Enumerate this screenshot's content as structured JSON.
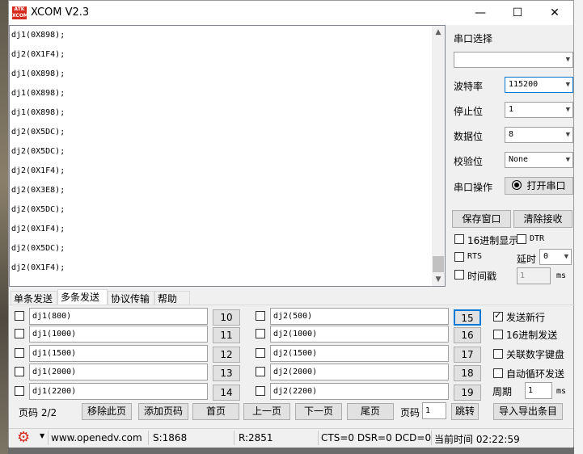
{
  "window": {
    "title": "XCOM V2.3",
    "logo_text": "ATK\nXCOM",
    "minimize": "—",
    "maximize": "☐",
    "close": "✕"
  },
  "receive": {
    "lines": [
      "dj1(0X898);",
      "dj2(0X1F4);",
      "dj1(0X898);",
      "dj1(0X898);",
      "dj1(0X898);",
      "dj2(0X5DC);",
      "dj2(0X5DC);",
      "dj2(0X1F4);",
      "dj2(0X3E8);",
      "dj2(0X5DC);",
      "dj2(0X1F4);",
      "dj2(0X5DC);",
      "dj2(0X1F4);"
    ]
  },
  "serial": {
    "port_select_label": "串口选择",
    "port_value": "",
    "baud_label": "波特率",
    "baud_value": "115200",
    "stop_label": "停止位",
    "stop_value": "1",
    "data_label": "数据位",
    "data_value": "8",
    "parity_label": "校验位",
    "parity_value": "None",
    "op_label": "串口操作",
    "open_button": "打开串口",
    "save_button": "保存窗口",
    "clear_button": "清除接收",
    "hex_display": "16进制显示",
    "dtr": "DTR",
    "rts": "RTS",
    "delay_label": "延时",
    "delay_value": "0",
    "timestamp": "时间戳",
    "timestamp_value": "1",
    "ms": "ms"
  },
  "tabs": [
    "单条发送",
    "多条发送",
    "协议传输",
    "帮助"
  ],
  "multi_send": {
    "left": [
      {
        "text": "dj1(800)",
        "num": "10"
      },
      {
        "text": "dj1(1000)",
        "num": "11"
      },
      {
        "text": "dj1(1500)",
        "num": "12"
      },
      {
        "text": "dj1(2000)",
        "num": "13"
      },
      {
        "text": "dj1(2200)",
        "num": "14"
      }
    ],
    "right": [
      {
        "text": "dj2(500)",
        "num": "15"
      },
      {
        "text": "dj2(1000)",
        "num": "16"
      },
      {
        "text": "dj2(1500)",
        "num": "17"
      },
      {
        "text": "dj2(2000)",
        "num": "18"
      },
      {
        "text": "dj2(2200)",
        "num": "19"
      }
    ],
    "options": {
      "send_newline": "发送新行",
      "hex_send": "16进制发送",
      "link_keypad": "关联数字键盘",
      "auto_loop": "自动循环发送",
      "period_label": "周期",
      "period_value": "1",
      "ms": "ms"
    },
    "page_label": "页码 2/2",
    "remove_page": "移除此页",
    "add_page": "添加页码",
    "first_page": "首页",
    "prev_page": "上一页",
    "next_page": "下一页",
    "last_page": "尾页",
    "goto_label": "页码",
    "goto_value": "1",
    "jump": "跳转",
    "import_export": "导入导出条目"
  },
  "status": {
    "url": "www.openedv.com",
    "sent": "S:1868",
    "recv": "R:2851",
    "signals": "CTS=0 DSR=0 DCD=0",
    "time": "当前时间 02:22:59"
  },
  "colors": {
    "accent": "#0078d7",
    "logo": "#d52b1e",
    "gear": "#d52b1e"
  }
}
